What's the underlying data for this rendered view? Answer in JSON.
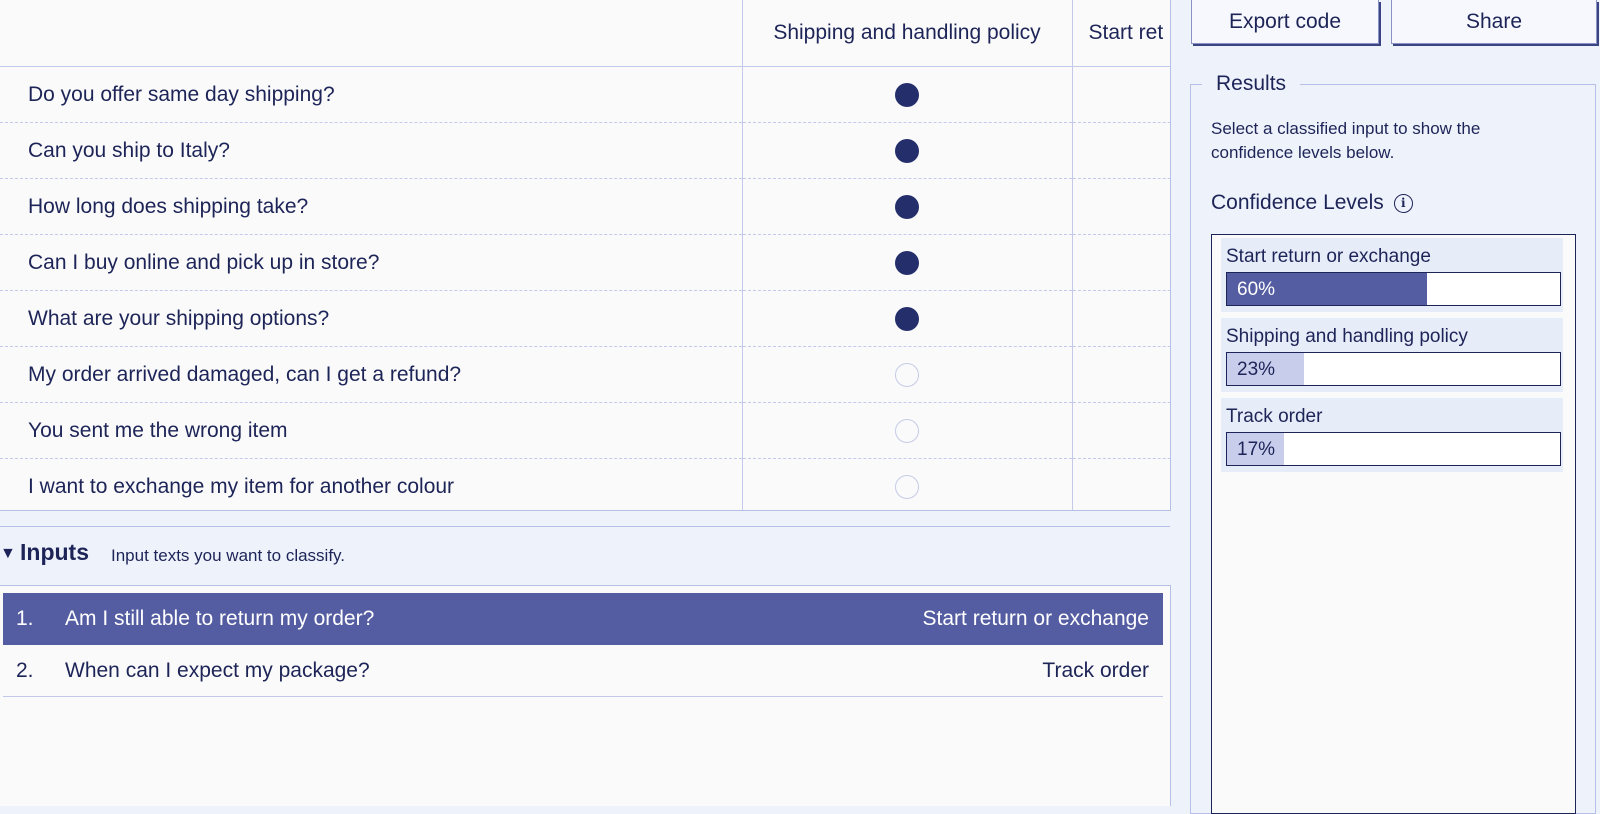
{
  "table": {
    "columns": [
      "Shipping and handling policy",
      "Start ret"
    ],
    "rows": [
      {
        "text": "Do you offer same day shipping?",
        "shipping": true
      },
      {
        "text": "Can you ship to Italy?",
        "shipping": true
      },
      {
        "text": "How long does shipping take?",
        "shipping": true
      },
      {
        "text": "Can I buy online and pick up in store?",
        "shipping": true
      },
      {
        "text": "What are your shipping options?",
        "shipping": true
      },
      {
        "text": "My order arrived damaged, can I get a refund?",
        "shipping": false
      },
      {
        "text": "You sent me the wrong item",
        "shipping": false
      },
      {
        "text": "I want to exchange my item for another colour",
        "shipping": false
      }
    ]
  },
  "inputs": {
    "title": "Inputs",
    "subtitle": "Input texts you want to classify.",
    "items": [
      {
        "num": "1.",
        "text": "Am I still able to return my order?",
        "label": "Start return or exchange",
        "selected": true
      },
      {
        "num": "2.",
        "text": "When can I expect my package?",
        "label": "Track order",
        "selected": false
      }
    ]
  },
  "toolbar": {
    "export_label": "Export code",
    "share_label": "Share"
  },
  "results": {
    "legend": "Results",
    "description": "Select a classified input to show the confidence levels below.",
    "confidence_title": "Confidence Levels",
    "info_icon": "info-icon",
    "levels": [
      {
        "name": "Start return or exchange",
        "pct_label": "60%",
        "value": 0.6,
        "color": "#555da2",
        "text_color": "#ffffff"
      },
      {
        "name": "Shipping and handling policy",
        "pct_label": "23%",
        "value": 0.23,
        "color": "#c8cdec",
        "text_color": "#1d2457"
      },
      {
        "name": "Track order",
        "pct_label": "17%",
        "value": 0.17,
        "color": "#c8cdec",
        "text_color": "#1d2457"
      }
    ]
  },
  "colors": {
    "accent": "#555da2",
    "dot_filled": "#242e6a",
    "text": "#1d2457",
    "background": "#eef2fb"
  }
}
